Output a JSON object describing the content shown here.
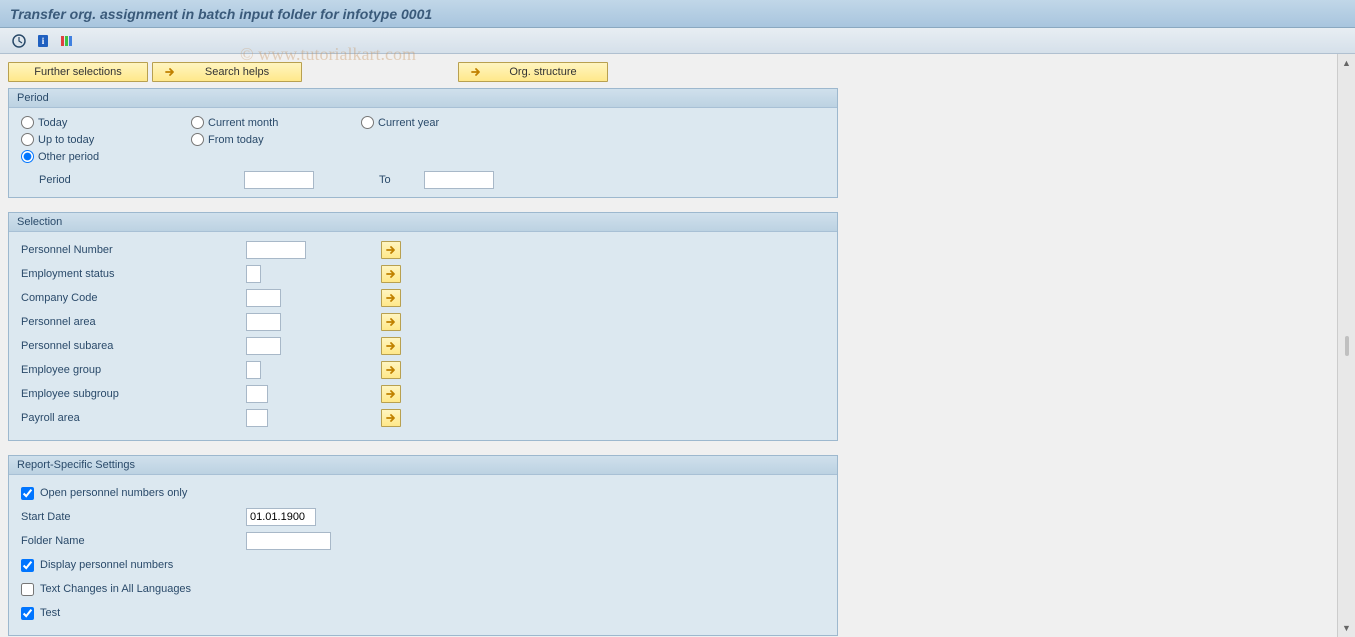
{
  "title": "Transfer org. assignment in batch input folder for infotype 0001",
  "watermark": "© www.tutorialkart.com",
  "buttons": {
    "further": "Further selections",
    "search": "Search helps",
    "org": "Org. structure"
  },
  "groups": {
    "period": {
      "title": "Period",
      "radios": {
        "today": "Today",
        "current_month": "Current month",
        "current_year": "Current year",
        "up_to_today": "Up to today",
        "from_today": "From today",
        "other": "Other period"
      },
      "period_label": "Period",
      "to_label": "To",
      "period_from": "",
      "period_to": ""
    },
    "selection": {
      "title": "Selection",
      "fields": {
        "pernr": "Personnel Number",
        "emp_status": "Employment status",
        "company": "Company Code",
        "parea": "Personnel area",
        "psubarea": "Personnel subarea",
        "egroup": "Employee group",
        "esubgroup": "Employee subgroup",
        "payroll": "Payroll area"
      },
      "values": {
        "pernr": "",
        "emp_status": "",
        "company": "",
        "parea": "",
        "psubarea": "",
        "egroup": "",
        "esubgroup": "",
        "payroll": ""
      }
    },
    "report": {
      "title": "Report-Specific Settings",
      "open_pernr": "Open personnel numbers only",
      "start_date_label": "Start Date",
      "start_date_value": "01.01.1900",
      "folder_label": "Folder Name",
      "folder_value": "",
      "display_pernr": "Display personnel numbers",
      "text_changes": "Text Changes in All Languages",
      "test": "Test"
    }
  }
}
